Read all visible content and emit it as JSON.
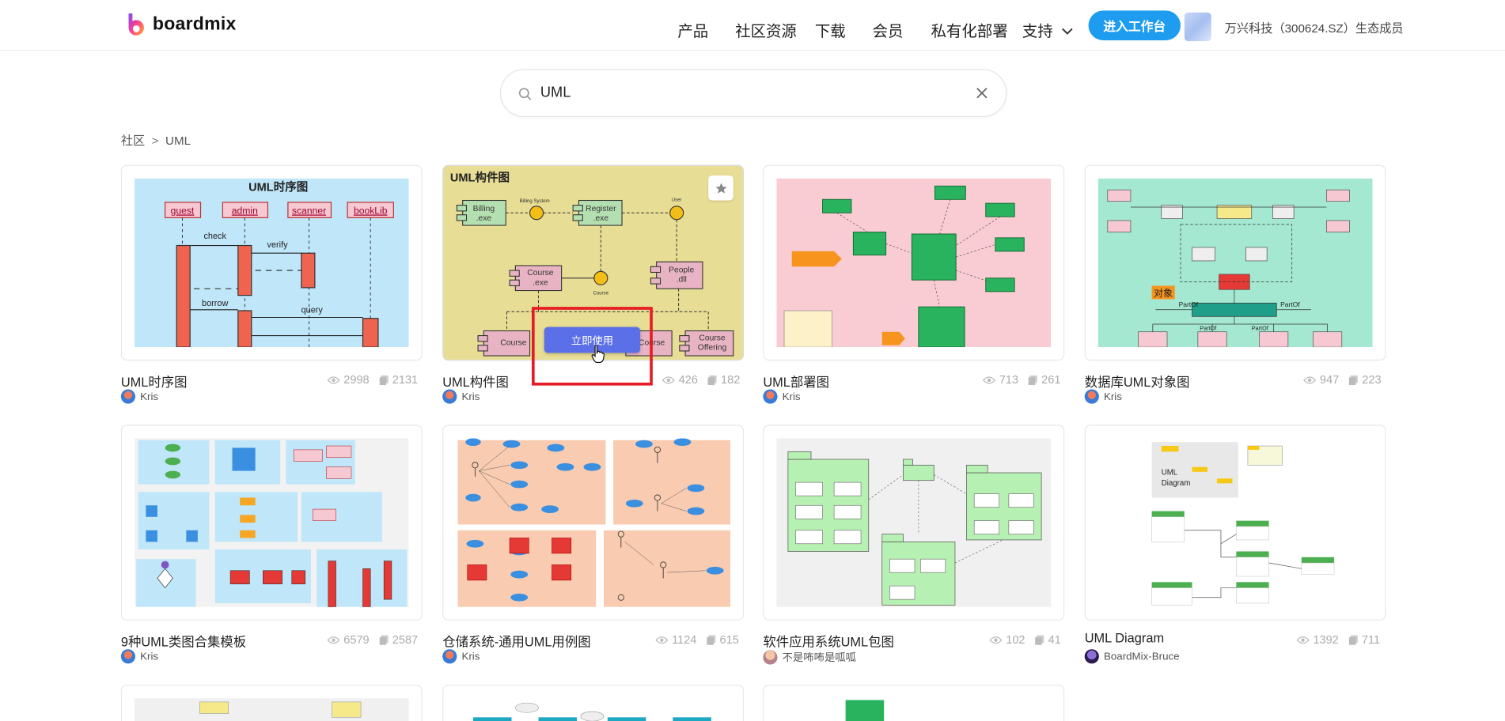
{
  "brand": {
    "name": "boardmix"
  },
  "nav": {
    "items": [
      "产品",
      "社区资源",
      "下载",
      "会员",
      "私有化部署",
      "支持"
    ],
    "cta": "进入工作台",
    "member_text": "万兴科技（300624.SZ）生态成员"
  },
  "search": {
    "value": "UML"
  },
  "breadcrumb": {
    "root": "社区",
    "sep": ">",
    "current": "UML"
  },
  "hover": {
    "use_label": "立即使用"
  },
  "cards": [
    {
      "title": "UML时序图",
      "views": "2998",
      "copies": "2131",
      "author": "Kris"
    },
    {
      "title": "UML构件图",
      "views": "426",
      "copies": "182",
      "author": "Kris"
    },
    {
      "title": "UML部署图",
      "views": "713",
      "copies": "261",
      "author": "Kris"
    },
    {
      "title": "数据库UML对象图",
      "views": "947",
      "copies": "223",
      "author": "Kris"
    },
    {
      "title": "9种UML类图合集模板",
      "views": "6579",
      "copies": "2587",
      "author": "Kris"
    },
    {
      "title": "仓储系统-通用UML用例图",
      "views": "1124",
      "copies": "615",
      "author": "Kris"
    },
    {
      "title": "软件应用系统UML包图",
      "views": "102",
      "copies": "41",
      "author": "不是咘咘是呱呱"
    },
    {
      "title": "UML Diagram",
      "views": "1392",
      "copies": "711",
      "author": "BoardMix-Bruce"
    }
  ],
  "thumbs": {
    "seq": {
      "title": "UML时序图",
      "actors": [
        "guest",
        "admin",
        "scanner",
        "bookLib"
      ],
      "msgs": [
        "check",
        "verify",
        "borrow",
        "query"
      ]
    },
    "comp": {
      "title": "UML构件图",
      "boxes": [
        "Billing",
        ".exe",
        "Register",
        ".exe",
        "Course",
        ".exe",
        "People",
        ".dll",
        "Course",
        "Course",
        "Offering"
      ],
      "small": [
        "Billing System",
        "User",
        "Course"
      ]
    },
    "obj": {
      "tag": "对象",
      "labels": [
        "PartOf",
        "PartOf",
        "PartOf",
        "PartOf"
      ]
    },
    "diag": {
      "lines": [
        "UML",
        "Diagram"
      ]
    }
  },
  "colors": {
    "accent": "#1e9cf0",
    "use_button": "#5b6fe8",
    "highlight": "#e51c23"
  }
}
